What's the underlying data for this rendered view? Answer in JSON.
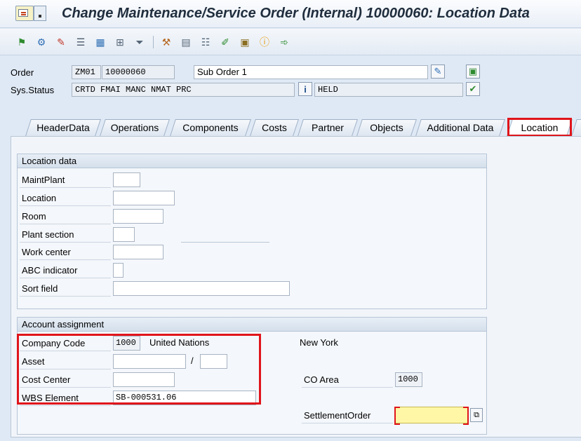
{
  "window": {
    "title": "Change Maintenance/Service Order (Internal) 10000060: Location Data"
  },
  "toolbar": {
    "icons": [
      "flag-icon",
      "settings-icon",
      "pencil-icon",
      "list-icon",
      "calculator-icon",
      "hierarchy-icon",
      "filter-icon",
      "tools-icon",
      "document-icon",
      "notes-icon",
      "edit-icon",
      "schedule-icon",
      "info-icon",
      "forward-icon"
    ]
  },
  "header": {
    "order_label": "Order",
    "order_type": "ZM01",
    "order_number": "10000060",
    "description": "Sub Order 1",
    "status_label": "Sys.Status",
    "system_status": "CRTD FMAI MANC NMAT PRC",
    "user_status": "HELD"
  },
  "tabs": [
    {
      "label": "HeaderData"
    },
    {
      "label": "Operations"
    },
    {
      "label": "Components"
    },
    {
      "label": "Costs"
    },
    {
      "label": "Partner"
    },
    {
      "label": "Objects"
    },
    {
      "label": "Additional Data"
    },
    {
      "label": "Location"
    }
  ],
  "location_data": {
    "title": "Location data",
    "maint_plant_label": "MaintPlant",
    "location_label": "Location",
    "room_label": "Room",
    "plant_section_label": "Plant section",
    "work_center_label": "Work center",
    "abc_indicator_label": "ABC indicator",
    "sort_field_label": "Sort field",
    "maint_plant": "",
    "location": "",
    "room": "",
    "plant_section": "",
    "work_center": "",
    "abc_indicator": "",
    "sort_field": ""
  },
  "account_assignment": {
    "title": "Account assignment",
    "company_code_label": "Company Code",
    "company_code": "1000",
    "company_name": "United Nations",
    "city": "New York",
    "asset_label": "Asset",
    "asset_separator": "/",
    "asset": "",
    "asset_sub": "",
    "cost_center_label": "Cost Center",
    "cost_center": "",
    "wbs_label": "WBS Element",
    "wbs_element": "SB-000531.06",
    "co_area_label": "CO Area",
    "co_area": "1000",
    "settlement_label": "SettlementOrder",
    "settlement_order": ""
  },
  "colors": {
    "highlight": "#e0151b",
    "background": "#dfe9f5",
    "required_field": "#fff7a6"
  }
}
